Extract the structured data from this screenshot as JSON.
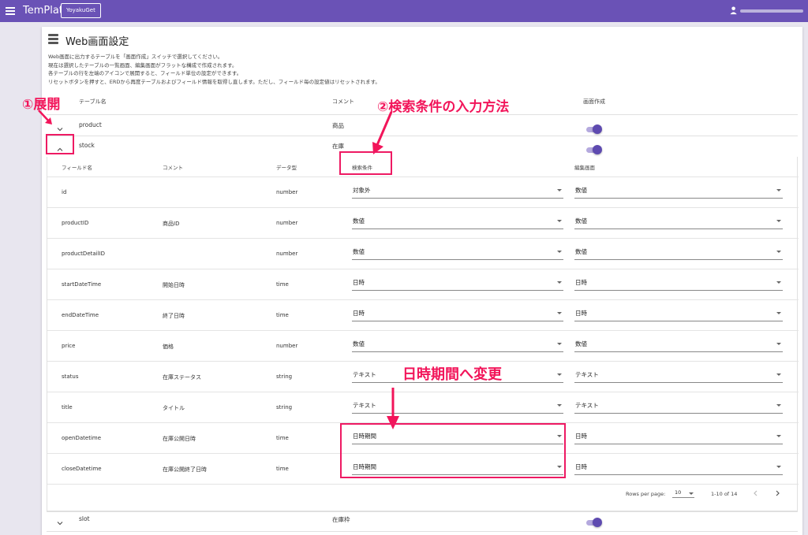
{
  "app": {
    "title": "TemPlat",
    "button_label": "YoyakuGet"
  },
  "page": {
    "title": "Web画面設定",
    "description": [
      "Web画面に出力するテーブルを「画面作成」スイッチで選択してください。",
      "現在は選択したテーブルの一覧画面、編集画面がフラットな構成で作成されます。",
      "各テーブルの行を左端のアイコンで展開すると、フィールド単位の設定ができます。",
      "リセットボタンを押すと、ERDから再度テーブルおよびフィールド情報を取得し直します。ただし、フィールド毎の設定値はリセットされます。"
    ]
  },
  "table": {
    "headers": {
      "name": "テーブル名",
      "comment": "コメント",
      "create": "画面作成"
    },
    "rows": [
      {
        "name": "product",
        "comment": "商品"
      },
      {
        "name": "stock",
        "comment": "在庫"
      },
      {
        "name": "slot",
        "comment": "在庫枠"
      }
    ]
  },
  "fields": {
    "headers": {
      "field": "フィールド名",
      "comment": "コメント",
      "type": "データ型",
      "search": "検索条件",
      "edit": "編集画面"
    },
    "rows": [
      {
        "field": "id",
        "comment": "",
        "type": "number",
        "search": "対象外",
        "edit": "数値"
      },
      {
        "field": "productID",
        "comment": "商品ID",
        "type": "number",
        "search": "数値",
        "edit": "数値"
      },
      {
        "field": "productDetailID",
        "comment": "",
        "type": "number",
        "search": "数値",
        "edit": "数値"
      },
      {
        "field": "startDateTime",
        "comment": "開始日時",
        "type": "time",
        "search": "日時",
        "edit": "日時"
      },
      {
        "field": "endDateTime",
        "comment": "終了日時",
        "type": "time",
        "search": "日時",
        "edit": "日時"
      },
      {
        "field": "price",
        "comment": "価格",
        "type": "number",
        "search": "数値",
        "edit": "数値"
      },
      {
        "field": "status",
        "comment": "在庫ステータス",
        "type": "string",
        "search": "テキスト",
        "edit": "テキスト"
      },
      {
        "field": "title",
        "comment": "タイトル",
        "type": "string",
        "search": "テキスト",
        "edit": "テキスト"
      },
      {
        "field": "openDatetime",
        "comment": "在庫公開日時",
        "type": "time",
        "search": "日時期間",
        "edit": "日時"
      },
      {
        "field": "closeDatetime",
        "comment": "在庫公開終了日時",
        "type": "time",
        "search": "日時期間",
        "edit": "日時"
      }
    ]
  },
  "pagination": {
    "rows_per_page_label": "Rows per page:",
    "rows_per_page": "10",
    "range": "1-10 of 14"
  },
  "annotations": {
    "expand": "①展開",
    "search_method": "②検索条件の入力方法",
    "change_period": "日時期間へ変更"
  },
  "colors": {
    "appbar": "#6a52b6",
    "toggle": "#5e4ab0",
    "annotation": "#f2155a"
  }
}
